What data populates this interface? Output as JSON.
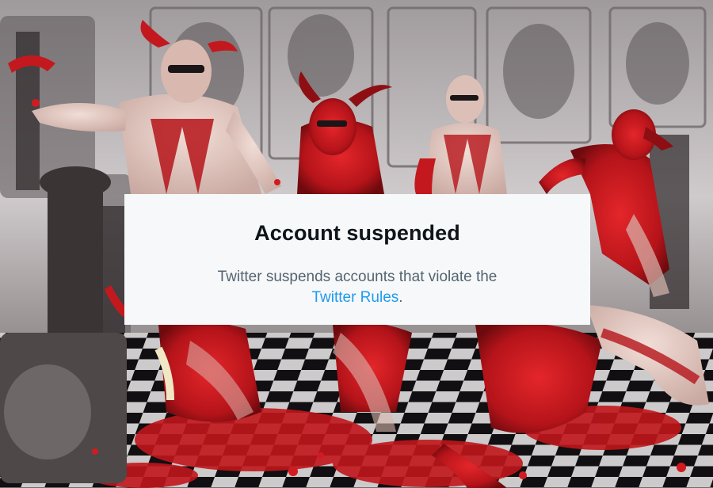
{
  "notice": {
    "title": "Account suspended",
    "message_line1": "Twitter suspends accounts that violate the",
    "link_text": "Twitter Rules",
    "link_suffix": "."
  },
  "colors": {
    "panel_background": "#f7f8f9",
    "title": "#0f1419",
    "body_text": "#536471",
    "link": "#1d9bf0",
    "blood_red": "#c0161b"
  }
}
